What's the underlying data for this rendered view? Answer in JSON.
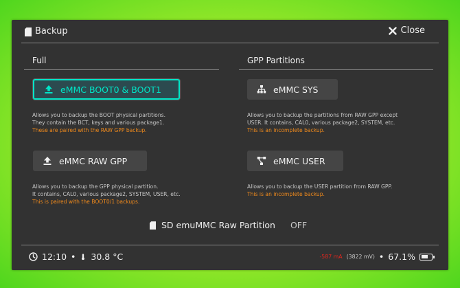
{
  "window": {
    "title": "Backup",
    "close_label": "Close"
  },
  "sections": {
    "full": {
      "title": "Full"
    },
    "gpp": {
      "title": "GPP Partitions"
    }
  },
  "buttons": {
    "boot": {
      "label": "eMMC BOOT0 & BOOT1",
      "icon": "upload-icon",
      "selected": true
    },
    "raw_gpp": {
      "label": "eMMC RAW GPP",
      "icon": "upload-icon"
    },
    "sys": {
      "label": "eMMC SYS",
      "icon": "sitemap-icon"
    },
    "user": {
      "label": "eMMC USER",
      "icon": "network-icon"
    }
  },
  "descriptions": {
    "boot": {
      "line1": "Allows you to backup the BOOT physical partitions.",
      "line2": "They contain the BCT, keys and various package1.",
      "note": "These are paired with the RAW GPP backup."
    },
    "raw_gpp": {
      "line1": "Allows you to backup the GPP physical partition.",
      "line2": "It contains, CAL0, various package2, SYSTEM, USER, etc.",
      "note": "This is paired with the BOOT0/1 backups."
    },
    "sys": {
      "line1": "Allows you to backup the partitions from RAW GPP except",
      "line2": "USER. It contains, CAL0, various package2, SYSTEM, etc.",
      "note": "This is an incomplete backup."
    },
    "user": {
      "line1": "Allows you to backup the USER partition from RAW GPP.",
      "note": "This is an incomplete backup."
    }
  },
  "emummc": {
    "label": "SD emuMMC Raw Partition",
    "state": "OFF"
  },
  "status": {
    "time": "12:10",
    "separator": "•",
    "temperature": "30.8 °C",
    "current": "-587 mA",
    "voltage": "(3822 mV)",
    "battery_percent": "67.1%",
    "battery_level": 0.671
  },
  "colors": {
    "accent": "#00e6c8",
    "warning": "#f08a1c",
    "current": "#e0261e",
    "panel": "#323232",
    "button": "#454545"
  }
}
